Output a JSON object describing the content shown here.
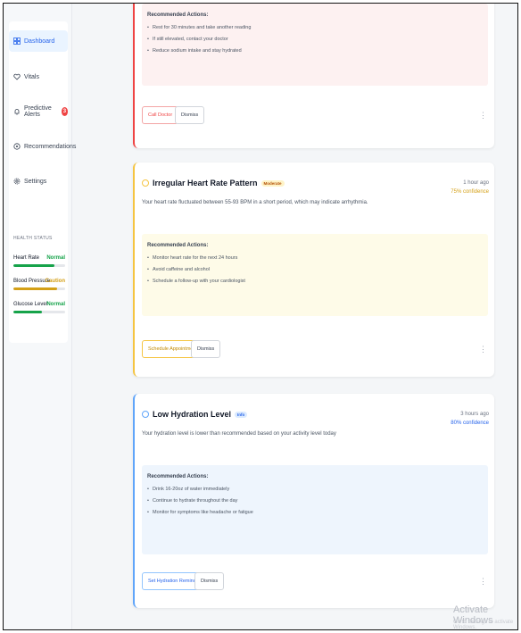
{
  "sidebar": {
    "nav": [
      {
        "label": "Dashboard",
        "icon": "dashboard-icon",
        "active": true
      },
      {
        "label": "Vitals",
        "icon": "heart-icon",
        "active": false
      },
      {
        "label": "Predictive Alerts",
        "icon": "bell-icon",
        "active": false,
        "badge": "3"
      },
      {
        "label": "Recommendations",
        "icon": "lightbulb-icon",
        "active": false
      },
      {
        "label": "Settings",
        "icon": "gear-icon",
        "active": false
      }
    ],
    "health_status": {
      "title": "HEALTH STATUS",
      "rows": [
        {
          "label": "Heart Rate",
          "status": "Normal",
          "color": "#16a34a",
          "level": 0.8
        },
        {
          "label": "Blood Pressure",
          "status": "Caution",
          "color": "#d4a017",
          "level": 0.85
        },
        {
          "label": "Glucose Level",
          "status": "Normal",
          "color": "#16a34a",
          "level": 0.55
        }
      ]
    }
  },
  "alerts": [
    {
      "id": "partial",
      "actions_title": "Recommended Actions:",
      "actions": [
        "Rest for 30 minutes and take another reading",
        "If still elevated, contact your doctor",
        "Reduce sodium intake and stay hydrated"
      ],
      "primary_button": "Call Doctor",
      "dismiss_button": "Dismiss"
    },
    {
      "id": "heart",
      "title": "Irregular Heart Rate Pattern",
      "severity": "Moderate",
      "description": "Your heart rate fluctuated between 55-93 BPM in a short period, which may indicate arrhythmia.",
      "time": "1 hour ago",
      "confidence": "75% confidence",
      "actions_title": "Recommended Actions:",
      "actions": [
        "Monitor heart rate for the next 24 hours",
        "Avoid caffeine and alcohol",
        "Schedule a follow-up with your cardiologist"
      ],
      "primary_button": "Schedule Appointment",
      "dismiss_button": "Dismiss"
    },
    {
      "id": "hydration",
      "title": "Low Hydration Level",
      "severity": "Info",
      "description": "Your hydration level is lower than recommended based on your activity level today",
      "time": "3 hours ago",
      "confidence": "80% confidence",
      "actions_title": "Recommended Actions:",
      "actions": [
        "Drink 16-20oz of water immediately",
        "Continue to hydrate throughout the day",
        "Monitor for symptoms like headache or fatigue"
      ],
      "primary_button": "Set Hydration Reminder",
      "dismiss_button": "Dismiss"
    }
  ],
  "kebab_glyph": "⋮",
  "watermark": {
    "line1": "Activate Windows",
    "line2": "Go to Settings to activate Windows."
  },
  "colors": {
    "red": "#ef4444",
    "yellow": "#f5c542",
    "blue": "#60a5fa",
    "green": "#16a34a",
    "accent": "#2563eb"
  }
}
